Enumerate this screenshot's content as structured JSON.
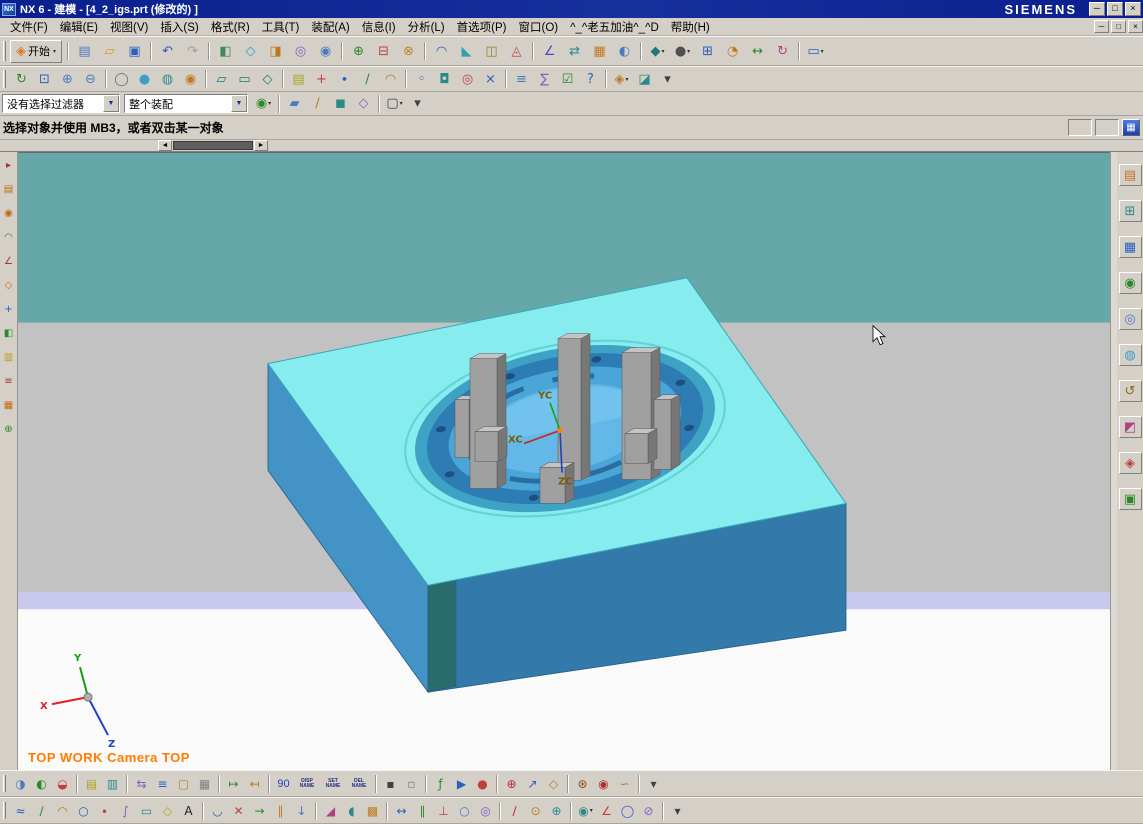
{
  "window": {
    "app_icon": "NX",
    "title": "NX 6 - 建模 - [4_2_igs.prt (修改的) ]",
    "brand": "SIEMENS",
    "controls": {
      "minimize": "─",
      "restore": "□",
      "close": "×"
    }
  },
  "menubar": {
    "items": [
      {
        "id": "file",
        "label": "文件(F)"
      },
      {
        "id": "edit",
        "label": "编辑(E)"
      },
      {
        "id": "view",
        "label": "视图(V)"
      },
      {
        "id": "insert",
        "label": "插入(S)"
      },
      {
        "id": "format",
        "label": "格式(R)"
      },
      {
        "id": "tools",
        "label": "工具(T)"
      },
      {
        "id": "assemblies",
        "label": "装配(A)"
      },
      {
        "id": "information",
        "label": "信息(I)"
      },
      {
        "id": "analysis",
        "label": "分析(L)"
      },
      {
        "id": "preferences",
        "label": "首选项(P)"
      },
      {
        "id": "window",
        "label": "窗口(O)"
      },
      {
        "id": "custom",
        "label": "^_^老五加油^_^D"
      },
      {
        "id": "help",
        "label": "帮助(H)"
      }
    ],
    "controls": {
      "minimize": "─",
      "restore": "□",
      "close": "×"
    }
  },
  "toolbar1": {
    "start_label": "开始",
    "icons": [
      {
        "n": "new-file-icon",
        "g": "▤",
        "c": "#4a7ac0"
      },
      {
        "n": "open-icon",
        "g": "▱",
        "c": "#d89a20"
      },
      {
        "n": "save-icon",
        "g": "▣",
        "c": "#2a5fc0"
      },
      {
        "n": "sep"
      },
      {
        "n": "undo-icon",
        "g": "↶",
        "c": "#2a5fc0"
      },
      {
        "n": "redo-icon",
        "g": "↷",
        "c": "#9a9aa0"
      },
      {
        "n": "sep"
      },
      {
        "n": "direct-sketch-icon",
        "g": "◧",
        "c": "#3a8a5a"
      },
      {
        "n": "datum-plane-icon",
        "g": "◇",
        "c": "#2fa0b8"
      },
      {
        "n": "extrude-icon",
        "g": "◨",
        "c": "#c07820"
      },
      {
        "n": "revolve-icon",
        "g": "◎",
        "c": "#8060c0"
      },
      {
        "n": "hole-icon",
        "g": "◉",
        "c": "#4a7ac0"
      },
      {
        "n": "sep"
      },
      {
        "n": "unite-icon",
        "g": "⊕",
        "c": "#2a8a2a"
      },
      {
        "n": "subtract-icon",
        "g": "⊟",
        "c": "#c04040"
      },
      {
        "n": "intersect-icon",
        "g": "⊗",
        "c": "#c08020"
      },
      {
        "n": "sep"
      },
      {
        "n": "edge-blend-icon",
        "g": "◠",
        "c": "#2a5fc0"
      },
      {
        "n": "chamfer-icon",
        "g": "◣",
        "c": "#2fa0b8"
      },
      {
        "n": "shell-icon",
        "g": "◫",
        "c": "#8a8a30"
      },
      {
        "n": "trim-body-icon",
        "g": "◬",
        "c": "#c04040"
      },
      {
        "n": "sep"
      },
      {
        "n": "measure-icon",
        "g": "∠",
        "c": "#4a4ac0"
      },
      {
        "n": "move-object-icon",
        "g": "⇄",
        "c": "#2a8a8a"
      },
      {
        "n": "pattern-icon",
        "g": "▦",
        "c": "#c07820"
      },
      {
        "n": "mirror-icon",
        "g": "◐",
        "c": "#4a7ac0"
      },
      {
        "n": "sep"
      },
      {
        "n": "orient-view-icon",
        "g": "◆",
        "c": "#207878",
        "arrow": true
      },
      {
        "n": "rendering-style-icon",
        "g": "●",
        "c": "#505050",
        "arrow": true
      },
      {
        "n": "fit-view-icon",
        "g": "⊞",
        "c": "#2a5fc0"
      },
      {
        "n": "zoom-icon",
        "g": "◔",
        "c": "#c07820"
      },
      {
        "n": "pan-icon",
        "g": "↔",
        "c": "#2a8a2a"
      },
      {
        "n": "rotate-view-icon",
        "g": "↻",
        "c": "#b04080"
      },
      {
        "n": "sep"
      },
      {
        "n": "window-menu-icon",
        "g": "▭",
        "c": "#2a5fc0",
        "arrow": true
      }
    ]
  },
  "toolbar2": {
    "icons": [
      {
        "n": "refresh-icon",
        "g": "↻",
        "c": "#2a8a2a"
      },
      {
        "n": "fit-icon",
        "g": "⊡",
        "c": "#2a5fc0"
      },
      {
        "n": "zoom-in-icon",
        "g": "⊕",
        "c": "#4a7ac0"
      },
      {
        "n": "zoom-out-icon",
        "g": "⊖",
        "c": "#4a7ac0"
      },
      {
        "n": "sep"
      },
      {
        "n": "wireframe-icon",
        "g": "◯",
        "c": "#707070"
      },
      {
        "n": "shaded-icon",
        "g": "●",
        "c": "#3aa0c8"
      },
      {
        "n": "shaded-edges-icon",
        "g": "◍",
        "c": "#2a8a8a"
      },
      {
        "n": "studio-render-icon",
        "g": "◉",
        "c": "#c07820"
      },
      {
        "n": "sep"
      },
      {
        "n": "front-view-icon",
        "g": "▱",
        "c": "#207878"
      },
      {
        "n": "top-view-icon",
        "g": "▭",
        "c": "#207878"
      },
      {
        "n": "isometric-view-icon",
        "g": "◇",
        "c": "#207878"
      },
      {
        "n": "sep"
      },
      {
        "n": "layer-icon",
        "g": "▤",
        "c": "#b0a020"
      },
      {
        "n": "wcs-icon",
        "g": "+",
        "c": "#c04040"
      },
      {
        "n": "point-icon",
        "g": "∙",
        "c": "#2a5fc0"
      },
      {
        "n": "line-icon",
        "g": "∕",
        "c": "#2a8a2a"
      },
      {
        "n": "arc-icon",
        "g": "◠",
        "c": "#c07820"
      },
      {
        "n": "sep"
      },
      {
        "n": "snap-end-icon",
        "g": "◦",
        "c": "#4a4ac0"
      },
      {
        "n": "snap-mid-icon",
        "g": "◘",
        "c": "#2a8a8a"
      },
      {
        "n": "snap-center-icon",
        "g": "◎",
        "c": "#c04040"
      },
      {
        "n": "snap-intersection-icon",
        "g": "×",
        "c": "#2a5fc0"
      },
      {
        "n": "sep"
      },
      {
        "n": "object-info-icon",
        "g": "≡",
        "c": "#4a7ac0"
      },
      {
        "n": "analysis-sum-icon",
        "g": "∑",
        "c": "#8060c0"
      },
      {
        "n": "preferences-check-icon",
        "g": "☑",
        "c": "#2a8a2a"
      },
      {
        "n": "help-icon",
        "g": "?",
        "c": "#2a5fc0"
      },
      {
        "n": "sep"
      },
      {
        "n": "role-icon",
        "g": "◈",
        "c": "#c07820",
        "arrow": true
      },
      {
        "n": "clip-section-icon",
        "g": "◪",
        "c": "#2a8a8a"
      },
      {
        "n": "more-tools-icon",
        "g": "▾",
        "c": "#404040"
      }
    ]
  },
  "filter_bar": {
    "selection_filter": "没有选择过滤器",
    "assembly_scope": "整个装配",
    "arrow": "▼",
    "icons": [
      {
        "n": "snap-point-toggle-icon",
        "g": "◉",
        "c": "#2a8a2a",
        "arrow": true
      },
      {
        "n": "sep"
      },
      {
        "n": "select-face-icon",
        "g": "▰",
        "c": "#4a7ac0"
      },
      {
        "n": "select-edge-icon",
        "g": "∕",
        "c": "#c07820"
      },
      {
        "n": "select-body-icon",
        "g": "◼",
        "c": "#2a8a8a"
      },
      {
        "n": "select-component-icon",
        "g": "◇",
        "c": "#8060c0"
      },
      {
        "n": "sep"
      },
      {
        "n": "rectangle-select-icon",
        "g": "▢",
        "c": "#404040",
        "arrow": true
      },
      {
        "n": "filter-more-icon",
        "g": "▾",
        "c": "#404040"
      }
    ]
  },
  "prompt_bar": {
    "message": "选择对象并使用 MB3，或者双击某一对象"
  },
  "splitter": {
    "left": "◄",
    "right": "►"
  },
  "viewport": {
    "status_text": "TOP WORK Camera TOP",
    "status_color": "#ff7c00",
    "wcs_labels": {
      "xc": "XC",
      "yc": "YC",
      "zc": "ZC"
    },
    "triad_labels": {
      "x": "X",
      "y": "Y",
      "z": "Z"
    },
    "colors": {
      "sky_band": "#66a7a9",
      "gray_band": "#c2c2c2",
      "lavender_band": "#c9c9ef",
      "floor": "#fafafa",
      "block_top": "#86ecee",
      "block_left": "#4493c6",
      "block_right": "#3379aa",
      "block_corner": "#2a6b6d",
      "pocket_ring": "#2e7cb4",
      "pocket_floor": "#63b8e8",
      "post_gray": "#a0a0a0"
    }
  },
  "left_toolbar": {
    "icons": [
      {
        "n": "select-tool-icon",
        "g": "▸",
        "c": "#b03030"
      },
      {
        "n": "part-navigator-mini-icon",
        "g": "▤",
        "c": "#c06a10"
      },
      {
        "n": "visibility-mini-icon",
        "g": "◉",
        "c": "#c06a10"
      },
      {
        "n": "curve-mini-icon",
        "g": "◠",
        "c": "#2a8a2a"
      },
      {
        "n": "dimension-mini-icon",
        "g": "∠",
        "c": "#b03030"
      },
      {
        "n": "plane-mini-icon",
        "g": "◇",
        "c": "#c06a10"
      },
      {
        "n": "axis-mini-icon",
        "g": "+",
        "c": "#2a5fc0"
      },
      {
        "n": "sketch-mini-icon",
        "g": "◧",
        "c": "#2a8a2a"
      },
      {
        "n": "layer-mini-icon",
        "g": "▥",
        "c": "#b0a020"
      },
      {
        "n": "note-mini-icon",
        "g": "≡",
        "c": "#b03030"
      },
      {
        "n": "grid-mini-icon",
        "g": "▦",
        "c": "#c06a10"
      },
      {
        "n": "wcs-mini-icon",
        "g": "⊕",
        "c": "#2a8a2a"
      }
    ]
  },
  "resource_bar": {
    "icons": [
      {
        "n": "assembly-navigator-icon",
        "g": "▤",
        "c": "#c07820"
      },
      {
        "n": "constraint-navigator-icon",
        "g": "⊞",
        "c": "#2a8a8a"
      },
      {
        "n": "part-navigator-icon",
        "g": "▦",
        "c": "#2a5fc0"
      },
      {
        "n": "reuse-library-icon",
        "g": "◉",
        "c": "#2a8a2a"
      },
      {
        "n": "hd3d-tools-icon",
        "g": "◎",
        "c": "#4a7ac0"
      },
      {
        "n": "web-browser-icon",
        "g": "◍",
        "c": "#3aa0c8"
      },
      {
        "n": "history-icon",
        "g": "↺",
        "c": "#8a6a20"
      },
      {
        "n": "materials-icon",
        "g": "◩",
        "c": "#b04080"
      },
      {
        "n": "roles-icon",
        "g": "◈",
        "c": "#c04040"
      },
      {
        "n": "system-scenes-icon",
        "g": "▣",
        "c": "#2a8a2a"
      }
    ]
  },
  "bottom_toolbar1": {
    "icons": [
      {
        "n": "edit-object-display-icon",
        "g": "◑",
        "c": "#4a7ac0"
      },
      {
        "n": "show-hide-icon",
        "g": "◐",
        "c": "#2a8a2a"
      },
      {
        "n": "immediate-hide-icon",
        "g": "◒",
        "c": "#c04040"
      },
      {
        "n": "sep"
      },
      {
        "n": "layer-settings-icon",
        "g": "▤",
        "c": "#b0a020"
      },
      {
        "n": "layer-in-view-icon",
        "g": "▥",
        "c": "#2a8a8a"
      },
      {
        "n": "sep"
      },
      {
        "n": "transform-icon",
        "g": "⇆",
        "c": "#8060c0"
      },
      {
        "n": "object-information-icon",
        "g": "≡",
        "c": "#2a5fc0"
      },
      {
        "n": "class-selection-icon",
        "g": "▢",
        "c": "#c07820"
      },
      {
        "n": "work-grid-icon",
        "g": "▦",
        "c": "#808080"
      },
      {
        "n": "sep"
      },
      {
        "n": "export-icon",
        "g": "↦",
        "c": "#2a8a2a"
      },
      {
        "n": "import-icon",
        "g": "↤",
        "c": "#c07820"
      },
      {
        "n": "sep"
      },
      {
        "n": "rotate-90-icon",
        "t": "90",
        "c": "#2040c0"
      },
      {
        "n": "display-name-icon",
        "t": "DISP NAME",
        "c": "#203080",
        "micro": true
      },
      {
        "n": "set-name-icon",
        "t": "SET NAME",
        "c": "#203080",
        "micro": true
      },
      {
        "n": "delete-name-icon",
        "t": "DEL NAME",
        "c": "#203080",
        "micro": true
      },
      {
        "n": "sep"
      },
      {
        "n": "lock-icon",
        "g": "▪",
        "c": "#404040"
      },
      {
        "n": "unlock-icon",
        "g": "▫",
        "c": "#808080"
      },
      {
        "n": "sep"
      },
      {
        "n": "expression-icon",
        "g": "ƒ",
        "c": "#2a8a2a"
      },
      {
        "n": "macro-play-icon",
        "g": "▶",
        "c": "#2a5fc0"
      },
      {
        "n": "macro-record-icon",
        "g": "●",
        "c": "#c04040"
      },
      {
        "n": "sep"
      },
      {
        "n": "datum-csys-icon",
        "g": "⊕",
        "c": "#b03030"
      },
      {
        "n": "vector-icon",
        "g": "↗",
        "c": "#2a5fc0"
      },
      {
        "n": "plane-icon",
        "g": "◇",
        "c": "#c07820"
      },
      {
        "n": "sep"
      },
      {
        "n": "gear-icon",
        "g": "⊛",
        "c": "#8a4a10"
      },
      {
        "n": "bolt-icon",
        "g": "◉",
        "c": "#b03030"
      },
      {
        "n": "spring-icon",
        "g": "∽",
        "c": "#c07820"
      },
      {
        "n": "sep"
      },
      {
        "n": "toolbar-overflow-icon",
        "g": "▾",
        "c": "#404040"
      }
    ]
  },
  "bottom_toolbar2": {
    "icons": [
      {
        "n": "profile-icon",
        "g": "≈",
        "c": "#2a5fc0"
      },
      {
        "n": "line-curve-icon",
        "g": "∕",
        "c": "#2a8a2a"
      },
      {
        "n": "arc-curve-icon",
        "g": "◠",
        "c": "#c07820"
      },
      {
        "n": "circle-curve-icon",
        "g": "○",
        "c": "#2a5fc0"
      },
      {
        "n": "point-curve-icon",
        "g": "∙",
        "c": "#c04040"
      },
      {
        "n": "spline-icon",
        "g": "∫",
        "c": "#8060c0"
      },
      {
        "n": "rectangle-curve-icon",
        "g": "▭",
        "c": "#2a8a8a"
      },
      {
        "n": "polygon-icon",
        "g": "◇",
        "c": "#b0a020"
      },
      {
        "n": "text-icon",
        "g": "A",
        "c": "#202020"
      },
      {
        "n": "sep"
      },
      {
        "n": "fillet-icon",
        "g": "◡",
        "c": "#2a5fc0"
      },
      {
        "n": "trim-curve-icon",
        "g": "✕",
        "c": "#c04040"
      },
      {
        "n": "extend-icon",
        "g": "→",
        "c": "#2a8a2a"
      },
      {
        "n": "offset-curve-icon",
        "g": "∥",
        "c": "#c07820"
      },
      {
        "n": "project-curve-icon",
        "g": "↓",
        "c": "#4a7ac0"
      },
      {
        "n": "sep"
      },
      {
        "n": "quick-trim-icon",
        "g": "◢",
        "c": "#b04080"
      },
      {
        "n": "mirror-curve-icon",
        "g": "◖",
        "c": "#2a8a8a"
      },
      {
        "n": "pattern-curve-icon",
        "g": "▩",
        "c": "#c07820"
      },
      {
        "n": "sep"
      },
      {
        "n": "dimension-icon",
        "g": "↔",
        "c": "#2a5fc0"
      },
      {
        "n": "parallel-constraint-icon",
        "g": "∥",
        "c": "#2a8a2a"
      },
      {
        "n": "perpendicular-constraint-icon",
        "g": "⊥",
        "c": "#c04040"
      },
      {
        "n": "tangent-constraint-icon",
        "g": "○",
        "c": "#4a7ac0"
      },
      {
        "n": "coincident-constraint-icon",
        "g": "◎",
        "c": "#8060c0"
      },
      {
        "n": "sep"
      },
      {
        "n": "datum-axis-icon",
        "g": "∕",
        "c": "#b03030"
      },
      {
        "n": "datum-point-icon",
        "g": "⊙",
        "c": "#c07820"
      },
      {
        "n": "csys-icon",
        "g": "⊕",
        "c": "#2a8a8a"
      },
      {
        "n": "sep"
      },
      {
        "n": "snap-settings-icon",
        "g": "◉",
        "c": "#2a8a8a",
        "arrow": true
      },
      {
        "n": "angle-snap-icon",
        "g": "∠",
        "c": "#c04040"
      },
      {
        "n": "circle-snap-icon",
        "g": "◯",
        "c": "#2a5fc0"
      },
      {
        "n": "ellipse-snap-icon",
        "g": "⊘",
        "c": "#8060c0"
      },
      {
        "n": "sep"
      },
      {
        "n": "toolbar-overflow2-icon",
        "g": "▾",
        "c": "#404040"
      }
    ]
  }
}
